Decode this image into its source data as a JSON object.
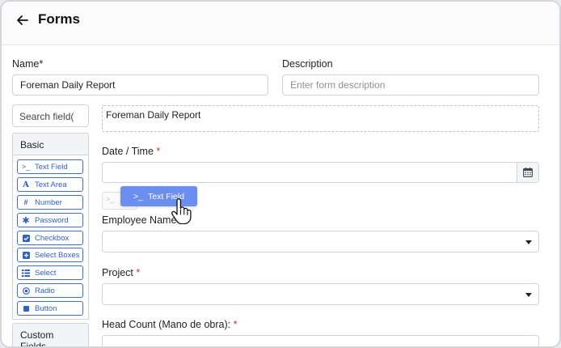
{
  "header": {
    "title": "Forms",
    "back_icon": "arrow-left-icon"
  },
  "form": {
    "name_label": "Name",
    "name_required_mark": "*",
    "name_value": "Foreman Daily Report",
    "description_label": "Description",
    "description_placeholder": "Enter form description"
  },
  "builder": {
    "search_placeholder": "Search field(",
    "groups": {
      "basic": "Basic",
      "custom": "Custom Fields"
    },
    "components": [
      {
        "label": "Text Field",
        "icon": "terminal-icon"
      },
      {
        "label": "Text Area",
        "icon": "font-icon"
      },
      {
        "label": "Number",
        "icon": "hashtag-icon"
      },
      {
        "label": "Password",
        "icon": "asterisk-icon"
      },
      {
        "label": "Checkbox",
        "icon": "checkbox-icon"
      },
      {
        "label": "Select Boxes",
        "icon": "plus-square-icon"
      },
      {
        "label": "Select",
        "icon": "list-icon"
      },
      {
        "label": "Radio",
        "icon": "radio-icon"
      },
      {
        "label": "Button",
        "icon": "button-square-icon"
      }
    ]
  },
  "canvas": {
    "title_text": "Foreman Daily Report",
    "fields": {
      "date_time": {
        "label": "Date / Time",
        "required": "*"
      },
      "employee_name": {
        "label": "Employee Name"
      },
      "project": {
        "label": "Project",
        "required": "*"
      },
      "head_count": {
        "label": "Head Count (Mano de obra):",
        "required": "*"
      }
    },
    "drag_chip": {
      "label": "Text Field",
      "icon": "terminal-icon"
    },
    "drop_placeholder": ">_"
  },
  "colors": {
    "accent": "#2f62c8",
    "drag_chip": "#6b8ff0",
    "required": "#d9302c"
  }
}
